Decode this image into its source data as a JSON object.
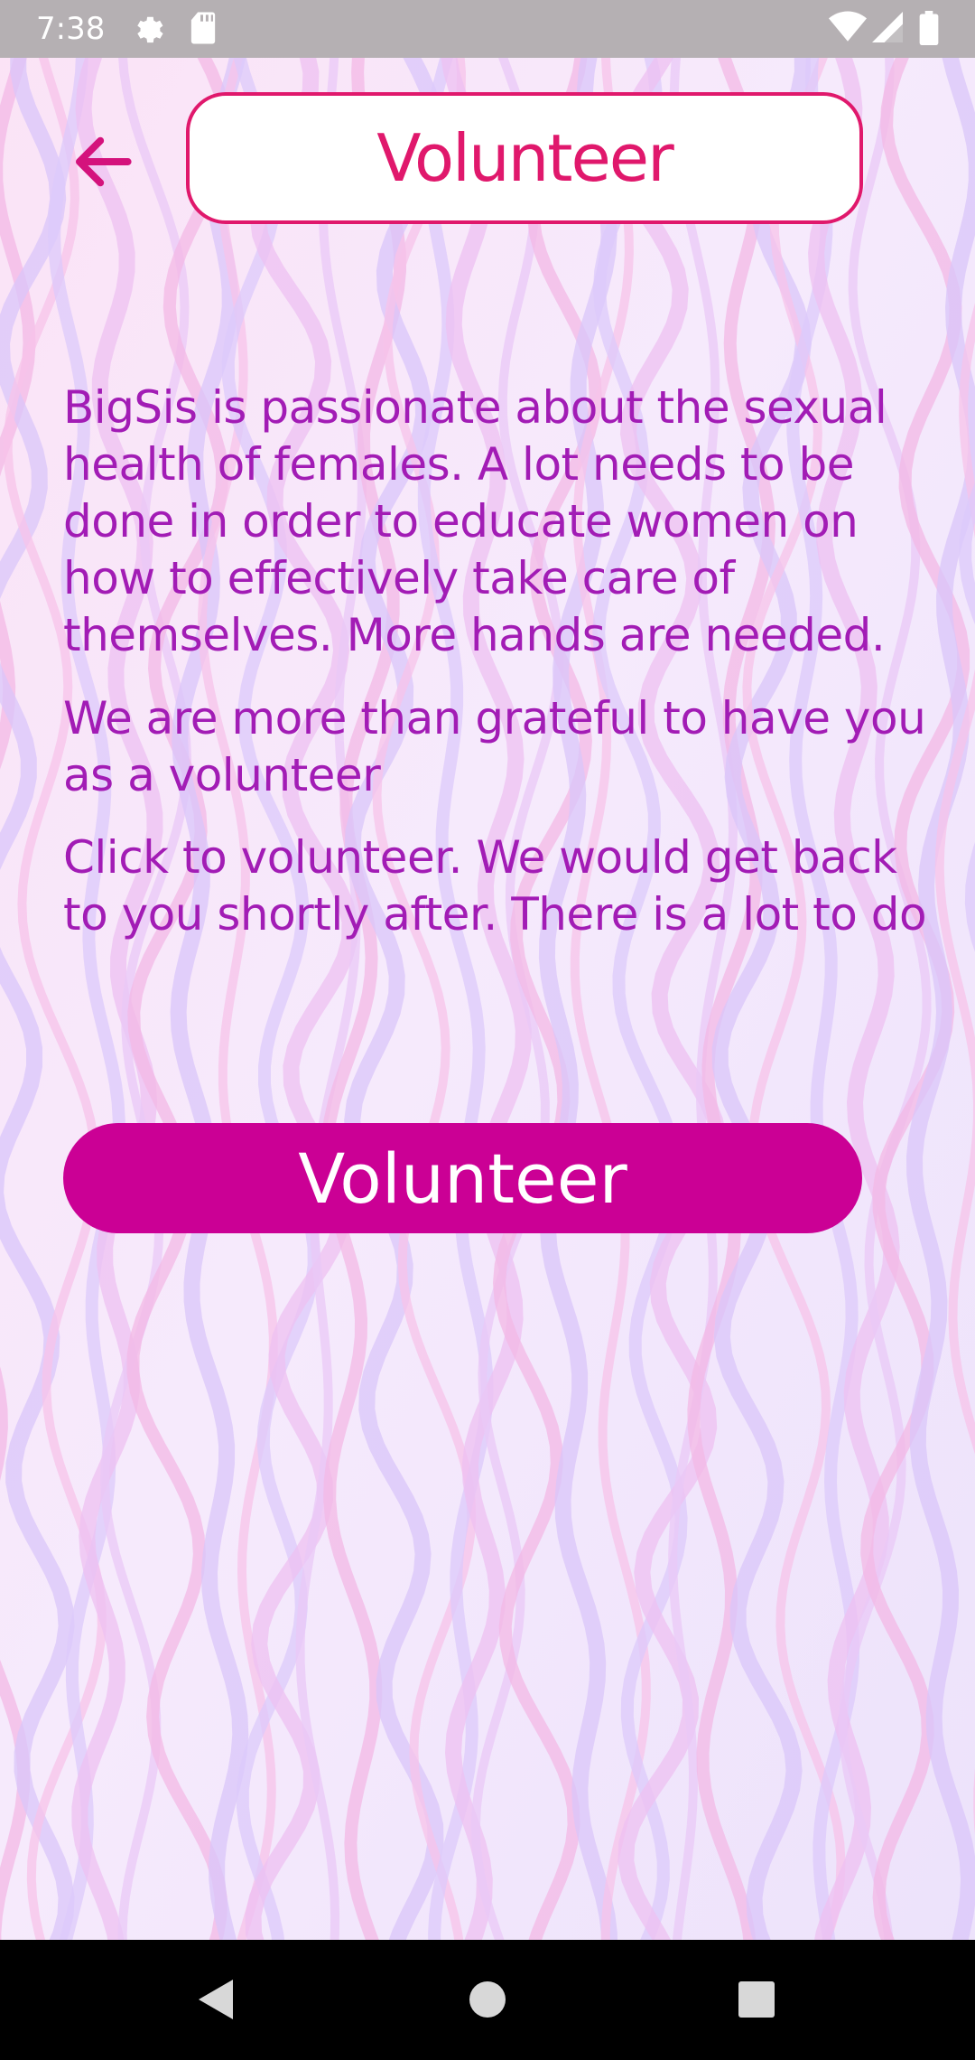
{
  "status_bar": {
    "time": "7:38",
    "left_icons": [
      "settings-icon",
      "sd-card-icon"
    ],
    "right_icons": [
      "wifi-icon",
      "cell-signal-icon",
      "battery-icon"
    ]
  },
  "header": {
    "back_icon": "arrow-back-icon",
    "title": "Volunteer"
  },
  "body": {
    "paragraph_1": "BigSis is passionate about the sexual health of females. A lot needs to be done in order to educate women on how to effectively take care of themselves. More hands are needed.",
    "paragraph_2": "We are more than grateful to have you as a volunteer",
    "paragraph_3": "Click to volunteer. We would get back to you shortly after. There is a lot to do"
  },
  "action": {
    "volunteer_label": "Volunteer"
  },
  "nav_bar": {
    "buttons": [
      "back-triangle-icon",
      "home-circle-icon",
      "recents-square-icon"
    ]
  },
  "colors": {
    "accent_pink": "#e0186c",
    "button_magenta": "#cb0095",
    "text_purple": "#a21cb5",
    "status_bar_gray": "#b5b0b3"
  }
}
